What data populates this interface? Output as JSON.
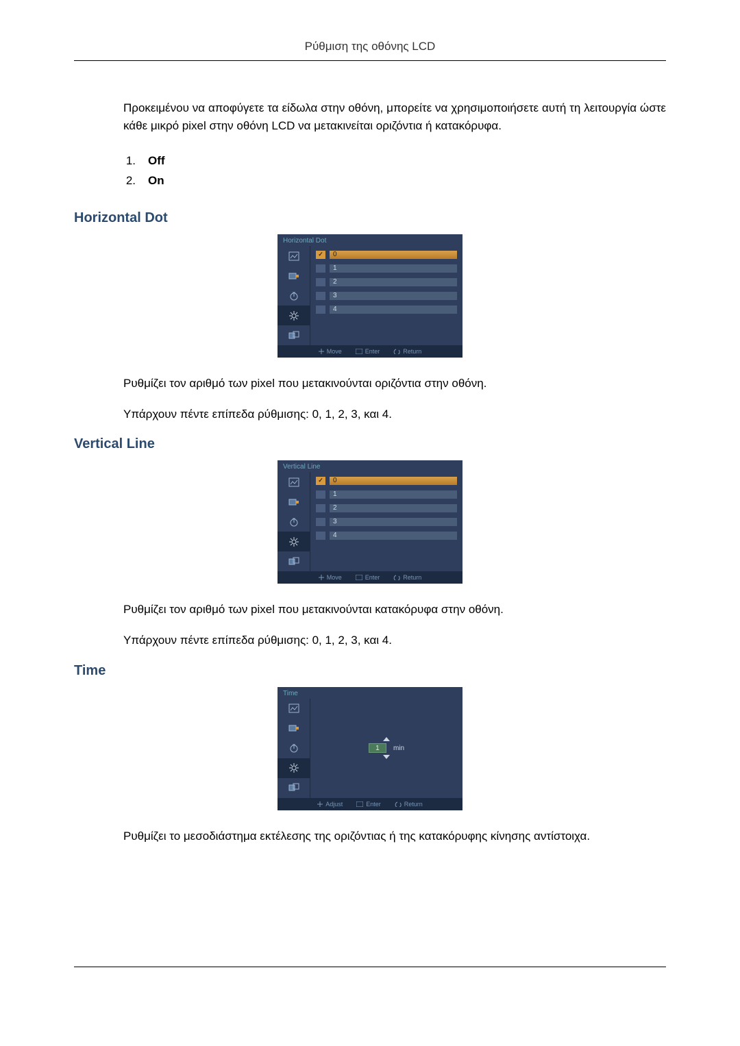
{
  "header": {
    "title": "Ρύθμιση της οθόνης LCD"
  },
  "intro": "Προκειμένου να αποφύγετε τα είδωλα στην οθόνη, μπορείτε να χρησιμοποιήσετε αυτή τη λειτουργία ώστε κάθε μικρό pixel στην οθόνη LCD να μετακινείται οριζόντια ή κατακόρυφα.",
  "options": [
    {
      "num": "1.",
      "label": "Off"
    },
    {
      "num": "2.",
      "label": "On"
    }
  ],
  "horizontal": {
    "heading": "Horizontal Dot",
    "desc1": "Ρυθμίζει τον αριθμό των pixel που μετακινούνται οριζόντια στην οθόνη.",
    "desc2": "Υπάρχουν πέντε επίπεδα ρύθμισης: 0, 1, 2, 3, και 4."
  },
  "vertical": {
    "heading": "Vertical Line",
    "desc1": "Ρυθμίζει τον αριθμό των pixel που μετακινούνται κατακόρυφα στην οθόνη.",
    "desc2": "Υπάρχουν πέντε επίπεδα ρύθμισης: 0, 1, 2, 3, και 4."
  },
  "time": {
    "heading": "Time",
    "desc": "Ρυθμίζει το μεσοδιάστημα εκτέλεσης της οριζόντιας ή της κατακόρυφης κίνησης αντίστοιχα."
  },
  "osd": {
    "horizontal": {
      "title": "Horizontal Dot",
      "values": [
        "0",
        "1",
        "2",
        "3",
        "4"
      ],
      "selected_index": 0
    },
    "vertical": {
      "title": "Vertical Line",
      "values": [
        "0",
        "1",
        "2",
        "3",
        "4"
      ],
      "selected_index": 0
    },
    "time": {
      "title": "Time",
      "value": "1",
      "unit": "min"
    },
    "footer_move": {
      "move": "Move",
      "enter": "Enter",
      "return": "Return"
    },
    "footer_adjust": {
      "adjust": "Adjust",
      "enter": "Enter",
      "return": "Return"
    }
  }
}
